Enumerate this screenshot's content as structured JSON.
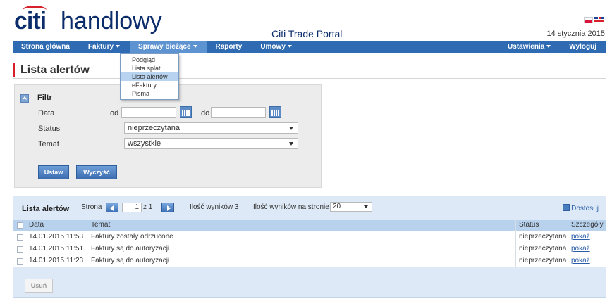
{
  "brand": {
    "citi": "citi",
    "handlowy": "handlowy"
  },
  "portal_title": "Citi Trade Portal",
  "date": "14 stycznia 2015",
  "nav": {
    "items": [
      {
        "label": "Strona główna"
      },
      {
        "label": "Faktury"
      },
      {
        "label": "Sprawy bieżące"
      },
      {
        "label": "Raporty"
      },
      {
        "label": "Umowy"
      }
    ],
    "right": [
      {
        "label": "Ustawienia"
      },
      {
        "label": "Wyloguj"
      }
    ]
  },
  "dropdown": {
    "items": [
      {
        "label": "Podgląd"
      },
      {
        "label": "Lista spłat"
      },
      {
        "label": "Lista alertów"
      },
      {
        "label": "eFaktury"
      },
      {
        "label": "Pisma"
      }
    ]
  },
  "page_title": "Lista alertów",
  "filter": {
    "toggle_icon": "⮝",
    "heading": "Filtr",
    "data_label": "Data",
    "od_label": "od",
    "do_label": "do",
    "od_value": "",
    "do_value": "",
    "status_label": "Status",
    "status_value": "nieprzeczytana",
    "temat_label": "Temat",
    "temat_value": "wszystkie",
    "ustaw": "Ustaw",
    "wyczysc": "Wyczyść"
  },
  "results": {
    "title": "Lista alertów",
    "strona_label": "Strona",
    "page": "1",
    "of_text": "z 1",
    "count_text": "Ilość wyników 3",
    "perpage_label": "Ilość wyników na stronie",
    "perpage_value": "20",
    "dostosuj": "Dostosuj",
    "columns": {
      "data": "Data",
      "temat": "Temat",
      "status": "Status",
      "szczegoly": "Szczegóły"
    },
    "rows": [
      {
        "data": "14.01.2015 11:53",
        "temat": "Faktury zostały odrzucone",
        "status": "nieprzeczytana",
        "link": "pokaż"
      },
      {
        "data": "14.01.2015 11:51",
        "temat": "Faktury są do autoryzacji",
        "status": "nieprzeczytana",
        "link": "pokaż"
      },
      {
        "data": "14.01.2015 11:23",
        "temat": "Faktury są do autoryzacji",
        "status": "nieprzeczytana",
        "link": "pokaż"
      }
    ],
    "usun": "Usuń"
  },
  "colors": {
    "nav": "#2f6bb2",
    "brand": "#0b2c6b",
    "accent_red": "#d8202c",
    "link": "#2a5ea8"
  }
}
